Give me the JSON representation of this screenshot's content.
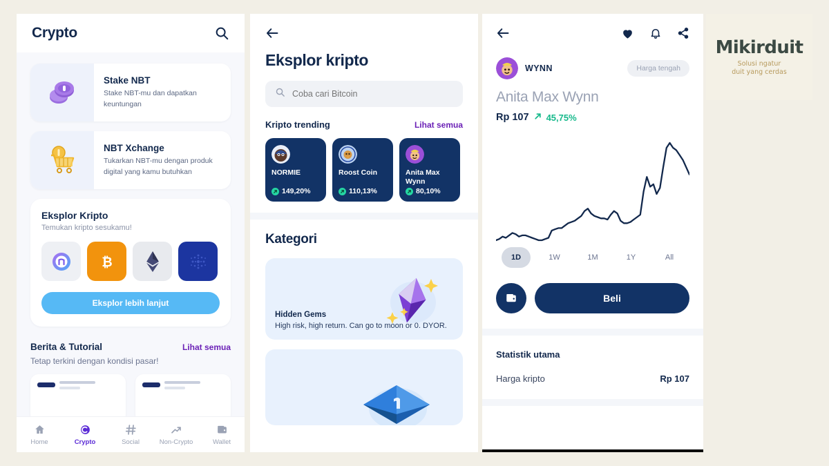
{
  "background_color": "#f2efe6",
  "brand": {
    "name": "Mikirduit",
    "tagline_line1": "Solusi ngatur",
    "tagline_line2": "duit yang cerdas",
    "name_color": "#3c4a44",
    "tagline_color": "#b79a5d",
    "panel_color": "#f4f1e6"
  },
  "screen1": {
    "header": {
      "title": "Crypto",
      "search_icon": "search-icon"
    },
    "promos": [
      {
        "icon": "purple-coin-stack-icon",
        "title": "Stake NBT",
        "subtitle": "Stake NBT-mu dan dapatkan keuntungan"
      },
      {
        "icon": "gold-shopping-cart-coin-icon",
        "title": "NBT Xchange",
        "subtitle": "Tukarkan NBT-mu dengan produk digital yang kamu butuhkan"
      }
    ],
    "explore": {
      "title": "Eksplor Kripto",
      "subtitle": "Temukan kripto sesukamu!",
      "button_label": "Eksplor lebih lanjut",
      "button_color": "#56b9f5",
      "coins": [
        {
          "name": "nbt-coin-icon",
          "bg": "#eef0f4",
          "symbol": "n"
        },
        {
          "name": "bitcoin-icon",
          "bg": "#f2930d",
          "symbol": "₿"
        },
        {
          "name": "ethereum-icon",
          "bg": "#e8eaee",
          "symbol": "⧫"
        },
        {
          "name": "cardano-icon",
          "bg": "#1c35a0",
          "symbol": "⋮"
        },
        {
          "name": "binance-icon",
          "bg": "#f3c324",
          "symbol": ""
        }
      ]
    },
    "news": {
      "title": "Berita & Tutorial",
      "see_all": "Lihat semua",
      "subtitle": "Tetap terkini dengan kondisi pasar!"
    },
    "tabs": [
      {
        "label": "Home",
        "icon": "home-icon",
        "active": false
      },
      {
        "label": "Crypto",
        "icon": "crypto-coin-icon",
        "active": true
      },
      {
        "label": "Social",
        "icon": "hashtag-icon",
        "active": false
      },
      {
        "label": "Non-Crypto",
        "icon": "trend-arrow-icon",
        "active": false
      },
      {
        "label": "Wallet",
        "icon": "wallet-icon",
        "active": false
      }
    ],
    "active_tab_color": "#5b2bd6"
  },
  "screen2": {
    "back_icon": "back-arrow-icon",
    "title": "Eksplor kripto",
    "search": {
      "placeholder": "Coba cari Bitcoin",
      "icon": "search-icon"
    },
    "trending": {
      "heading": "Kripto trending",
      "see_all": "Lihat semua",
      "cards": [
        {
          "name": "NORMIE",
          "change": "149,20%",
          "avatar": "normie-avatar"
        },
        {
          "name": "Roost Coin",
          "change": "110,13%",
          "avatar": "roost-avatar"
        },
        {
          "name": "Anita Max Wynn",
          "change": "80,10%",
          "avatar": "wynn-avatar"
        }
      ],
      "card_bg": "#123366",
      "up_color": "#25d6a3"
    },
    "categories": {
      "heading": "Kategori",
      "items": [
        {
          "name": "Hidden Gems",
          "description": "High risk, high return. Can go to moon or 0. DYOR.",
          "art": "purple-gem-icon",
          "bg": "#e8f1fd"
        },
        {
          "name": "",
          "description": "",
          "art": "blue-cube-icon",
          "bg": "#e8f1fd"
        }
      ]
    }
  },
  "screen3": {
    "back_icon": "back-arrow-icon",
    "actions": [
      {
        "name": "favorite-heart-icon"
      },
      {
        "name": "notification-bell-icon"
      },
      {
        "name": "share-icon"
      }
    ],
    "coin": {
      "symbol": "WYNN",
      "avatar": "wynn-avatar",
      "badge": "Harga tengah",
      "name": "Anita Max Wynn",
      "price": "Rp 107",
      "change": "45,75%",
      "change_color": "#16b98b",
      "trend_icon": "up-arrow-icon"
    },
    "ranges": [
      {
        "label": "1D",
        "active": true
      },
      {
        "label": "1W",
        "active": false
      },
      {
        "label": "1M",
        "active": false
      },
      {
        "label": "1Y",
        "active": false
      },
      {
        "label": "All",
        "active": false
      }
    ],
    "buy": {
      "wallet_icon": "wallet-icon",
      "label": "Beli",
      "color": "#123366"
    },
    "stats": {
      "title": "Statistik utama",
      "rows": [
        {
          "label": "Harga kripto",
          "value": "Rp 107"
        }
      ]
    },
    "chart_data": {
      "type": "line",
      "title": "Anita Max Wynn price history",
      "xlabel": "",
      "ylabel": "",
      "line_color": "#12284c",
      "grid": false,
      "ylim": [
        0,
        100
      ],
      "x": [
        0,
        2,
        4,
        6,
        8,
        10,
        12,
        14,
        16,
        18,
        20,
        22,
        24,
        26,
        28,
        30,
        32,
        34,
        36,
        38,
        40,
        42,
        44,
        46,
        48,
        50,
        52,
        54,
        56,
        58,
        60,
        62,
        64,
        66,
        68,
        70,
        72,
        74,
        76,
        78,
        80,
        82,
        84,
        86,
        88,
        90,
        92,
        94,
        96,
        98,
        100
      ],
      "values": [
        12,
        13,
        15,
        14,
        16,
        18,
        17,
        15,
        16,
        16,
        15,
        14,
        13,
        12,
        12,
        13,
        14,
        20,
        21,
        22,
        22,
        24,
        26,
        27,
        28,
        30,
        32,
        36,
        38,
        34,
        32,
        31,
        30,
        30,
        29,
        33,
        36,
        34,
        28,
        26,
        26,
        27,
        29,
        31,
        33,
        52,
        64,
        56,
        58,
        50,
        55,
        72,
        88,
        92,
        88,
        86,
        82,
        78,
        72,
        66
      ]
    }
  }
}
